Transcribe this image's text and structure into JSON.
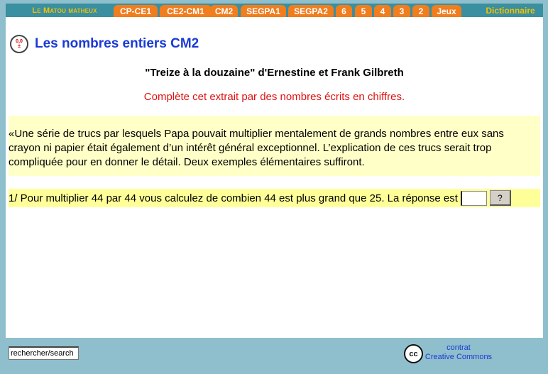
{
  "nav": {
    "brand": "Le Matou matheux",
    "tabs": [
      "CP-CE1",
      "CE2-CM1",
      "CM2",
      "SEGPA1",
      "SEGPA2",
      "6",
      "5",
      "4",
      "3",
      "2",
      "Jeux"
    ],
    "dictionary": "Dictionnaire"
  },
  "page": {
    "icon_top": "0,0",
    "icon_bottom": "±",
    "title": "Les nombres entiers CM2",
    "book": "\"Treize à la douzaine\" d'Ernestine et Frank Gilbreth",
    "instruction": "Complète cet extrait par des nombres écrits en chiffres."
  },
  "excerpt": {
    "text": "«Une série de trucs par lesquels Papa pouvait multiplier mentalement de grands nombres entre eux sans crayon ni papier était également d’un intérêt général exceptionnel. L’explication de ces trucs serait trop compliquée pour en donner le détail. Deux exemples élémentaires suffiront."
  },
  "question": {
    "text": "1/ Pour multiplier 44 par 44 vous calculez de combien 44 est plus grand que 25. La réponse est",
    "answer_value": "",
    "check_label": "?"
  },
  "footer": {
    "search_value": "rechercher/search",
    "cc_icon": "cc",
    "cc_line1": "contrat",
    "cc_line2": "Creative Commons"
  },
  "colors": {
    "background": "#8fbfcc",
    "nav_bar": "#3a8fa0",
    "tab": "#f07d1e",
    "brand": "#f2c200",
    "title": "#1a3ad6",
    "instruction": "#e01010",
    "excerpt_bg": "#ffffc8",
    "question_bg": "#ffff99"
  }
}
